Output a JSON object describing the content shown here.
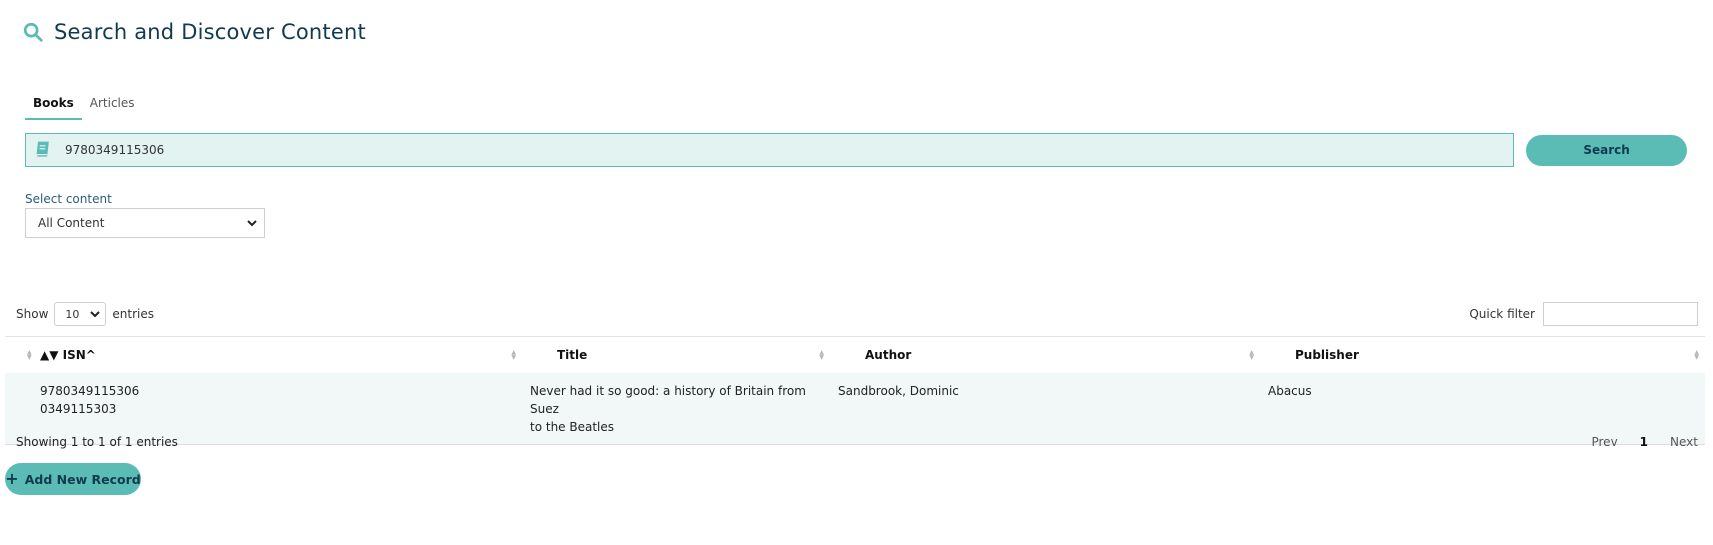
{
  "header": {
    "title": "Search and Discover Content",
    "icon": "search-icon"
  },
  "tabs": [
    {
      "label": "Books",
      "active": true
    },
    {
      "label": "Articles",
      "active": false
    }
  ],
  "search": {
    "value": "9780349115306",
    "placeholder": "",
    "button_label": "Search"
  },
  "content_select": {
    "label": "Select content",
    "selected": "All Content"
  },
  "table_controls": {
    "show_label": "Show",
    "entries_label": "entries",
    "page_length": "10",
    "quick_filter_label": "Quick filter"
  },
  "table": {
    "columns": [
      "ISN^",
      "Title",
      "Author",
      "Publisher"
    ],
    "rows": [
      {
        "isbn13": "9780349115306",
        "isbn10": "0349115303",
        "title_line1": "Never had it so good: a history of Britain from Suez",
        "title_line2": "to the Beatles",
        "author": "Sandbrook, Dominic",
        "publisher": "Abacus"
      }
    ]
  },
  "footer": {
    "info": "Showing 1 to 1 of 1 entries",
    "prev": "Prev",
    "page": "1",
    "next": "Next"
  },
  "add_button": {
    "label": "Add New Record"
  },
  "colors": {
    "accent": "#5bbcb5",
    "search_bg": "#e2f3f2",
    "title": "#123a4f"
  }
}
